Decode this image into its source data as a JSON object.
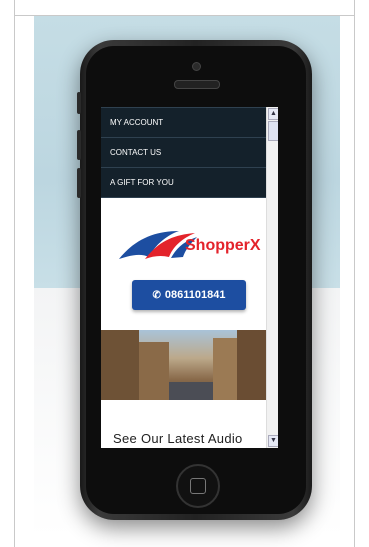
{
  "menu": {
    "items": [
      {
        "label": "MY ACCOUNT"
      },
      {
        "label": "CONTACT US"
      },
      {
        "label": "A GIFT FOR YOU"
      }
    ]
  },
  "logo": {
    "text": "ShopperX",
    "accent": "#e3232b",
    "brand_blue": "#1d4ea1"
  },
  "call": {
    "phone": "0861101841",
    "icon": "phone-icon"
  },
  "section": {
    "heading": "See Our Latest Audio"
  },
  "scrollbar": {
    "up_icon": "arrow-up-icon",
    "down_icon": "arrow-down-icon"
  }
}
